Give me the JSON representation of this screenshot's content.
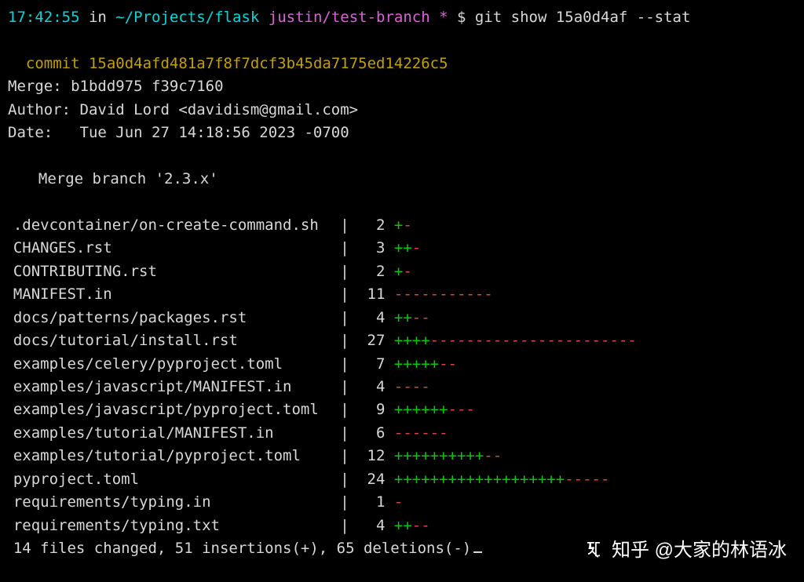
{
  "prompt": {
    "time": "17:42:55",
    "in_word": " in ",
    "path": "~/Projects/flask",
    "branch": " justin/test-branch ",
    "dirty": "*",
    "dollar": " $ ",
    "command": "git show 15a0d4af --stat"
  },
  "commit": {
    "label": "commit ",
    "hash": "15a0d4afd481a7f8f7dcf3b45da7175ed14226c5"
  },
  "meta": {
    "merge": "Merge: b1bdd975 f39c7160",
    "author": "Author: David Lord <davidism@gmail.com>",
    "date": "Date:   Tue Jun 27 14:18:56 2023 -0700"
  },
  "message": "Merge branch '2.3.x'",
  "files": [
    {
      "name": ".devcontainer/on-create-command.sh",
      "count": "2",
      "plus": "+",
      "minus": "-"
    },
    {
      "name": "CHANGES.rst",
      "count": "3",
      "plus": "++",
      "minus": "-"
    },
    {
      "name": "CONTRIBUTING.rst",
      "count": "2",
      "plus": "+",
      "minus": "-"
    },
    {
      "name": "MANIFEST.in",
      "count": "11",
      "plus": "",
      "minus": "-----------"
    },
    {
      "name": "docs/patterns/packages.rst",
      "count": "4",
      "plus": "++",
      "minus": "--"
    },
    {
      "name": "docs/tutorial/install.rst",
      "count": "27",
      "plus": "++++",
      "minus": "-----------------------"
    },
    {
      "name": "examples/celery/pyproject.toml",
      "count": "7",
      "plus": "+++++",
      "minus": "--"
    },
    {
      "name": "examples/javascript/MANIFEST.in",
      "count": "4",
      "plus": "",
      "minus": "----"
    },
    {
      "name": "examples/javascript/pyproject.toml",
      "count": "9",
      "plus": "++++++",
      "minus": "---"
    },
    {
      "name": "examples/tutorial/MANIFEST.in",
      "count": "6",
      "plus": "",
      "minus": "------"
    },
    {
      "name": "examples/tutorial/pyproject.toml",
      "count": "12",
      "plus": "++++++++++",
      "minus": "--"
    },
    {
      "name": "pyproject.toml",
      "count": "24",
      "plus": "+++++++++++++++++++",
      "minus": "-----"
    },
    {
      "name": "requirements/typing.in",
      "count": "1",
      "plus": "",
      "minus": "-"
    },
    {
      "name": "requirements/typing.txt",
      "count": "4",
      "plus": "++",
      "minus": "--"
    }
  ],
  "summary": "14 files changed, 51 insertions(+), 65 deletions(-)",
  "watermark": "知乎 @大家的林语冰"
}
